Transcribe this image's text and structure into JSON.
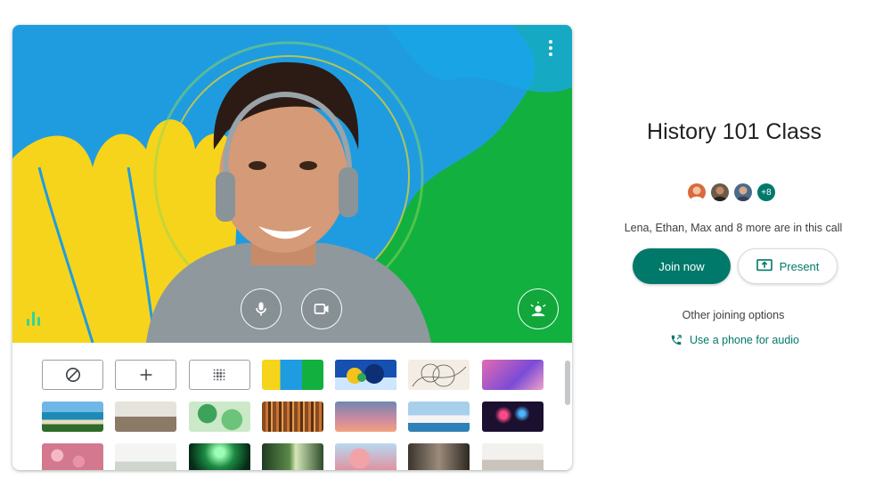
{
  "meeting": {
    "title": "History 101 Class",
    "participants_text": "Lena, Ethan, Max and 8 more are in this call",
    "more_count": "+8",
    "avatars": [
      "Lena",
      "Ethan",
      "Max"
    ]
  },
  "actions": {
    "join_label": "Join now",
    "present_label": "Present",
    "other_options_label": "Other joining options",
    "phone_label": "Use a phone for audio"
  },
  "preview": {
    "controls": [
      "more-options-icon",
      "microphone-icon",
      "camera-icon",
      "visual-effects-icon",
      "audio-level-icon"
    ]
  },
  "backgrounds": {
    "options": [
      "no-effect",
      "upload-background",
      "slight-blur"
    ],
    "images": [
      "abstract-blue-green",
      "abstract-circles",
      "line-art",
      "pink-leaves",
      "beach",
      "horses",
      "green-leaves",
      "bookshelf",
      "sunset-sky",
      "seaside-town",
      "fireworks",
      "pink-flowers",
      "white-room",
      "green-lights",
      "forest",
      "cherry-blossom",
      "loft",
      "kitchen"
    ]
  },
  "colors": {
    "accent": "#00796b",
    "preview_blue": "#1f9ce0",
    "preview_green": "#12b03f",
    "preview_yellow": "#f6d41b"
  }
}
